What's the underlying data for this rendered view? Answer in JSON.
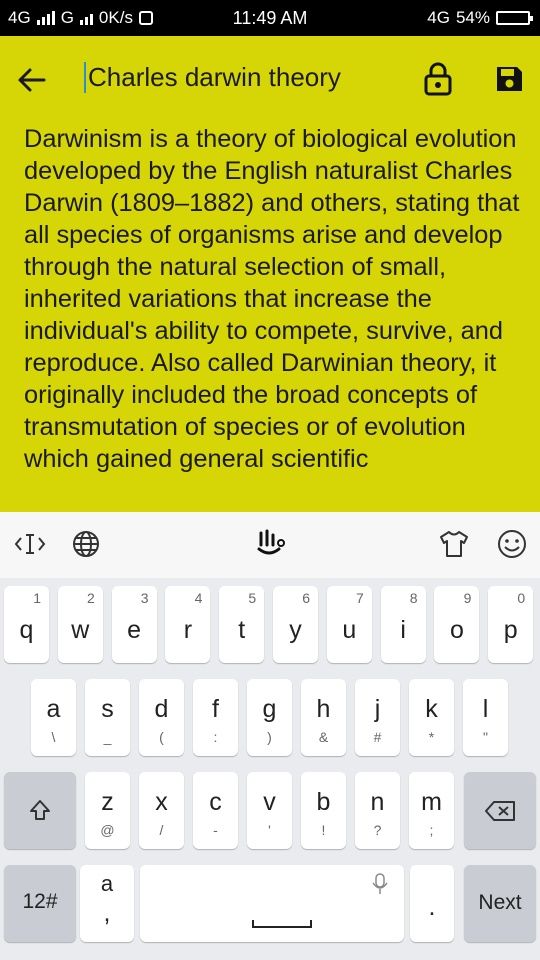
{
  "status_bar": {
    "network_left": "4G",
    "network_mid": "G",
    "speed": "0K/s",
    "time": "11:49 AM",
    "network_right": "4G",
    "battery": "54%"
  },
  "app_bar": {
    "title": "Charles darwin theory",
    "icons": [
      "back-arrow-icon",
      "lock-icon",
      "save-icon"
    ]
  },
  "note": {
    "body": "Darwinism is a theory of biological evolution developed by the English naturalist Charles Darwin (1809–1882) and others, stating that all species of organisms arise and develop through the natural selection of small, inherited variations that increase the individual's ability to compete, survive, and reproduce. Also called Darwinian theory, it originally included the broad concepts of transmutation of species or of evolution which gained general scientific"
  },
  "keyboard": {
    "toolbar_icons": [
      "cursor-icon",
      "globe-icon",
      "keyboard-logo-icon",
      "theme-shirt-icon",
      "emoji-icon"
    ],
    "row1": [
      {
        "k": "q",
        "h": "1"
      },
      {
        "k": "w",
        "h": "2"
      },
      {
        "k": "e",
        "h": "3"
      },
      {
        "k": "r",
        "h": "4"
      },
      {
        "k": "t",
        "h": "5"
      },
      {
        "k": "y",
        "h": "6"
      },
      {
        "k": "u",
        "h": "7"
      },
      {
        "k": "i",
        "h": "8"
      },
      {
        "k": "o",
        "h": "9"
      },
      {
        "k": "p",
        "h": "0"
      }
    ],
    "row2": [
      {
        "k": "a",
        "h": "\\"
      },
      {
        "k": "s",
        "h": "_"
      },
      {
        "k": "d",
        "h": "("
      },
      {
        "k": "f",
        "h": ":"
      },
      {
        "k": "g",
        "h": ")"
      },
      {
        "k": "h",
        "h": "&"
      },
      {
        "k": "j",
        "h": "#"
      },
      {
        "k": "k",
        "h": "*"
      },
      {
        "k": "l",
        "h": "\""
      }
    ],
    "row3": [
      {
        "k": "z",
        "h": "@"
      },
      {
        "k": "x",
        "h": "/"
      },
      {
        "k": "c",
        "h": "-"
      },
      {
        "k": "v",
        "h": "'"
      },
      {
        "k": "b",
        "h": "!"
      },
      {
        "k": "n",
        "h": "?"
      },
      {
        "k": "m",
        "h": ";"
      }
    ],
    "symbols_label": "12#",
    "comma_top": "a",
    "comma_label": ",",
    "period_label": ".",
    "next_label": "Next"
  },
  "colors": {
    "accent_bg": "#d6d606",
    "cursor": "#2a8fd6"
  }
}
